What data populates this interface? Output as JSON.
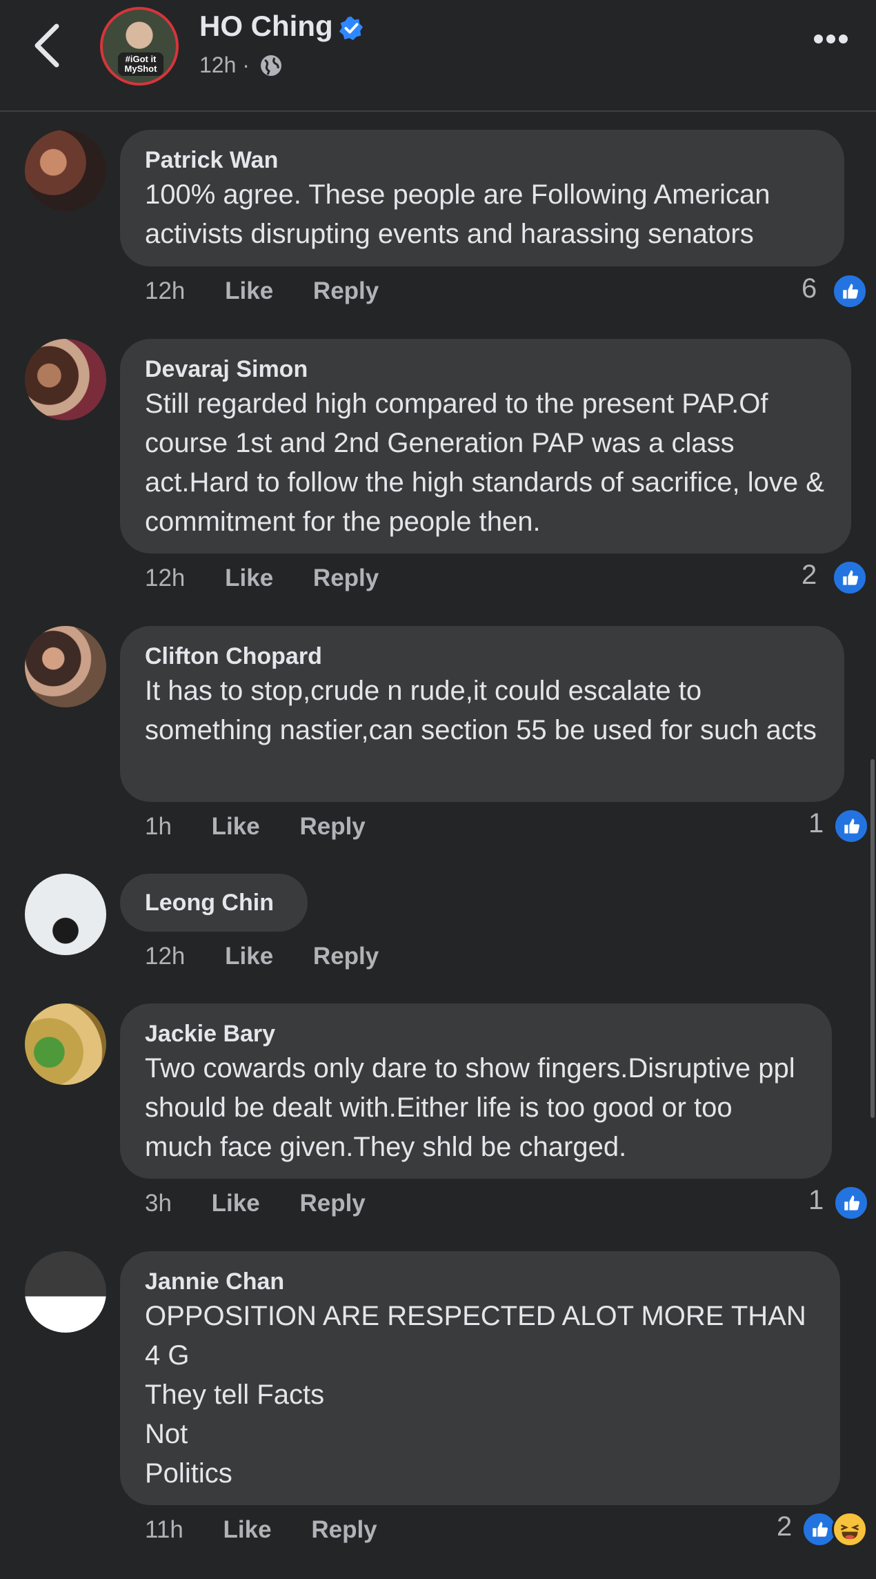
{
  "header": {
    "page_name": "HO Ching",
    "post_time": "12h ·",
    "avatar_badge": "#iGot it\nMyShot"
  },
  "colors": {
    "background": "#242526",
    "bubble": "#3a3b3c",
    "like_blue": "#2374e1",
    "verified_blue": "#2d88ff"
  },
  "comments": [
    {
      "author": "Patrick Wan",
      "text": "100% agree. These people are Following American activists disrupting events and harassing senators",
      "time": "12h",
      "like_label": "Like",
      "reply_label": "Reply",
      "reaction_count": "6",
      "reactions": [
        "like"
      ]
    },
    {
      "author": "Devaraj Simon",
      "text": "Still regarded high compared to the present PAP.Of course 1st and 2nd Generation PAP was a class act.Hard to follow the high standards of sacrifice, love & commitment for the people then.",
      "time": "12h",
      "like_label": "Like",
      "reply_label": "Reply",
      "reaction_count": "2",
      "reactions": [
        "like"
      ]
    },
    {
      "author": "Clifton Chopard",
      "text": "It has to stop,crude n rude,it could escalate to something nastier,can section 55 be used for such acts",
      "time": "1h",
      "like_label": "Like",
      "reply_label": "Reply",
      "reaction_count": "1",
      "reactions": [
        "like"
      ]
    },
    {
      "author": "Leong Chin",
      "text": "",
      "time": "12h",
      "like_label": "Like",
      "reply_label": "Reply"
    },
    {
      "author": "Jackie Bary",
      "text": "Two cowards only dare to show fingers.Disruptive ppl should be dealt with.Either life is too good or too much face given.They shld be charged.",
      "time": "3h",
      "like_label": "Like",
      "reply_label": "Reply",
      "reaction_count": "1",
      "reactions": [
        "like"
      ]
    },
    {
      "author": "Jannie Chan",
      "text": "OPPOSITION ARE RESPECTED ALOT MORE THAN 4 G\nThey tell Facts\nNot\nPolitics",
      "time": "11h",
      "like_label": "Like",
      "reply_label": "Reply",
      "reaction_count": "2",
      "reactions": [
        "like",
        "haha"
      ]
    }
  ]
}
